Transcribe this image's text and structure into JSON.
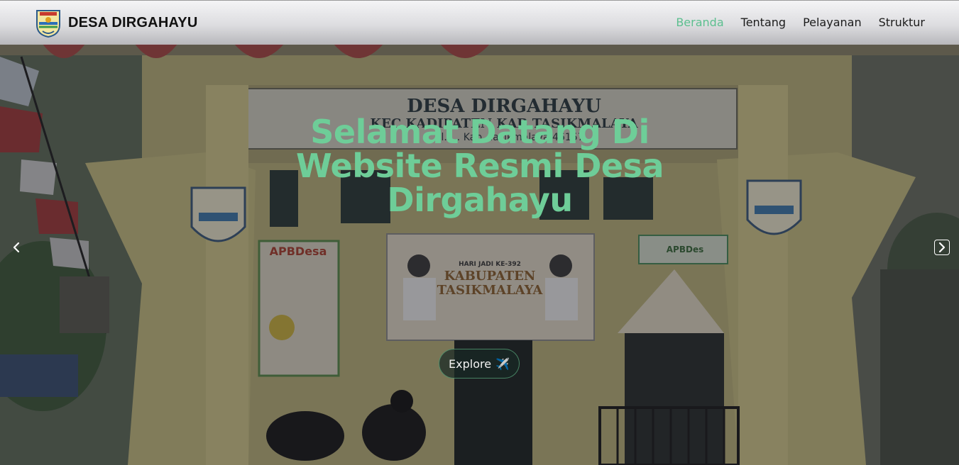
{
  "navbar": {
    "brand_name": "DESA DIRGAHAYU",
    "logo_icon": "village-emblem-icon",
    "links": [
      {
        "label": "Beranda",
        "active": true
      },
      {
        "label": "Tentang",
        "active": false
      },
      {
        "label": "Pelayanan",
        "active": false
      },
      {
        "label": "Struktur",
        "active": false
      }
    ],
    "active_color": "#5cbf8f"
  },
  "hero": {
    "title": "Selamat Datang Di Website Resmi Desa Dirgahayu",
    "title_color": "#6ecd98",
    "explore_label": "Explore",
    "explore_icon": "airplane-icon",
    "prev_icon": "chevron-left-icon",
    "next_icon": "chevron-right-icon"
  },
  "photo": {
    "sign_line_1": "DESA DIRGAHAYU",
    "sign_line_2": "KEC KADIPATEN KAB TASIKMALAYA",
    "sign_line_3": "Jl. … Kab. Tasikmalaya 46157",
    "banner_line_1": "HARI JADI KE-392",
    "banner_line_2": "KABUPATEN",
    "banner_line_3": "TASIKMALAYA",
    "board_left": "APBDesa",
    "board_right": "APBDes"
  }
}
